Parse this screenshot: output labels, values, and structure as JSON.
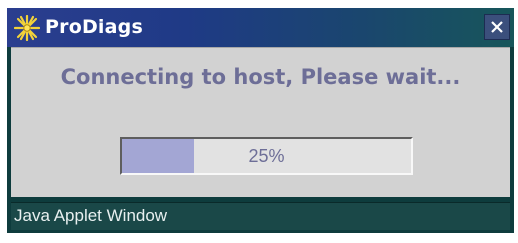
{
  "window": {
    "title": "ProDiags",
    "app_icon": "star-burst-icon",
    "close_icon": "close-icon"
  },
  "dialog": {
    "message": "Connecting to host, Please wait...",
    "progress": {
      "value_percent": 25,
      "label": "25%"
    }
  },
  "statusbar": {
    "text": "Java Applet Window"
  },
  "colors": {
    "frame": "#0e3c3d",
    "title_gradient_start": "#2b3e8f",
    "content_bg": "#d2d2d2",
    "text_accent": "#6d6e97",
    "progress_fill": "#a3a6d4"
  }
}
